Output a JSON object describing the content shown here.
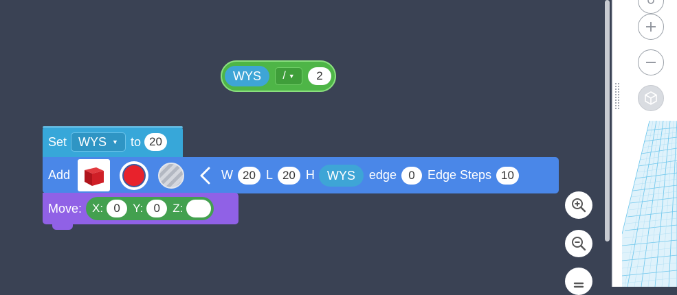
{
  "math_block": {
    "variable": "WYS",
    "operator": "/",
    "operand": "2"
  },
  "set_block": {
    "label": "Set",
    "variable": "WYS",
    "to_label": "to",
    "value": "20"
  },
  "add_block": {
    "label": "Add",
    "shape_icon": "red-cube",
    "color": "#e8222c",
    "w_label": "W",
    "w_value": "20",
    "l_label": "L",
    "l_value": "20",
    "h_label": "H",
    "h_variable": "WYS",
    "edge_label": "edge",
    "edge_value": "0",
    "edge_steps_label": "Edge Steps",
    "edge_steps_value": "10"
  },
  "move_block": {
    "label": "Move:",
    "x_label": "X:",
    "x_value": "0",
    "y_label": "Y:",
    "y_value": "0",
    "z_label": "Z:",
    "z_value": ""
  },
  "colors": {
    "workspace_bg": "#3a4254",
    "math_green": "#4eb547",
    "variable_blue": "#37a7d9",
    "add_blue": "#4a87e8",
    "move_purple": "#9061e6",
    "xyz_green": "#43a04f",
    "grid_blue": "#5bbde6"
  },
  "icons": {
    "zoom_in": "zoom-in-icon",
    "zoom_out": "zoom-out-icon",
    "recenter": "recenter-icon",
    "view_home": "home-icon",
    "view_zoom_in": "plus-icon",
    "view_zoom_out": "minus-icon",
    "view_cube": "view-cube-icon"
  }
}
